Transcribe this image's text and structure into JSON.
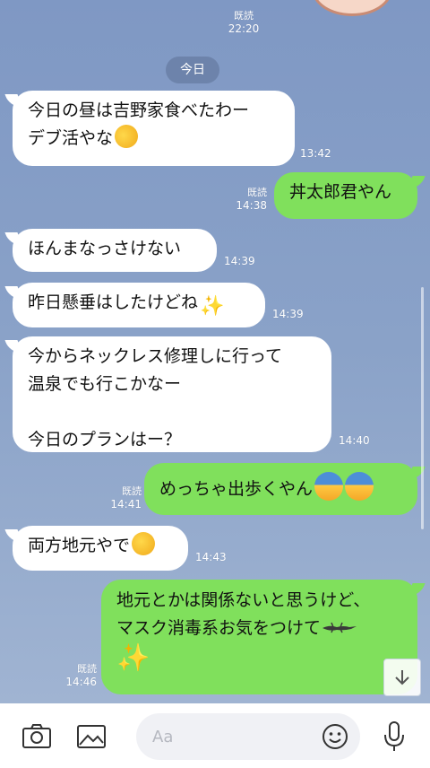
{
  "top_read": {
    "read": "既読",
    "time": "22:20"
  },
  "day_chip": "今日",
  "messages": [
    {
      "text": "今日の昼は吉野家食べたわー\nデブ活やな",
      "emoji": "rolling-on-floor-laughing-emoji",
      "time": "13:42"
    },
    {
      "text": "丼太郎君やん",
      "read": "既読",
      "time": "14:38"
    },
    {
      "text": "ほんまなっさけない",
      "time": "14:39"
    },
    {
      "text": "昨日懸垂はしたけどね",
      "emoji": "sparkles-emoji",
      "time": "14:39"
    },
    {
      "text": "今からネックレス修理しに行って\n温泉でも行こかなー\n\n今日のプランはー？",
      "time": "14:40"
    },
    {
      "text": "めっちゃ出歩くやん",
      "emoji": "fearful-face-emoji",
      "read": "既読",
      "time": "14:41"
    },
    {
      "text": "両方地元やで",
      "emoji": "grinning-face-emoji",
      "time": "14:43"
    },
    {
      "text": "地元とかは関係ないと思うけど、\nマスク消毒系お気をつけて",
      "emoji": "lizard-emoji",
      "read": "既読",
      "time": "14:46"
    }
  ],
  "composer": {
    "placeholder": "Aa"
  },
  "icons": [
    "camera-icon",
    "image-icon",
    "emoji-icon",
    "microphone-icon",
    "scroll-down-icon"
  ],
  "colors": {
    "incoming": "#ffffff",
    "outgoing": "#80e05c",
    "background": "#8aa2c8"
  }
}
